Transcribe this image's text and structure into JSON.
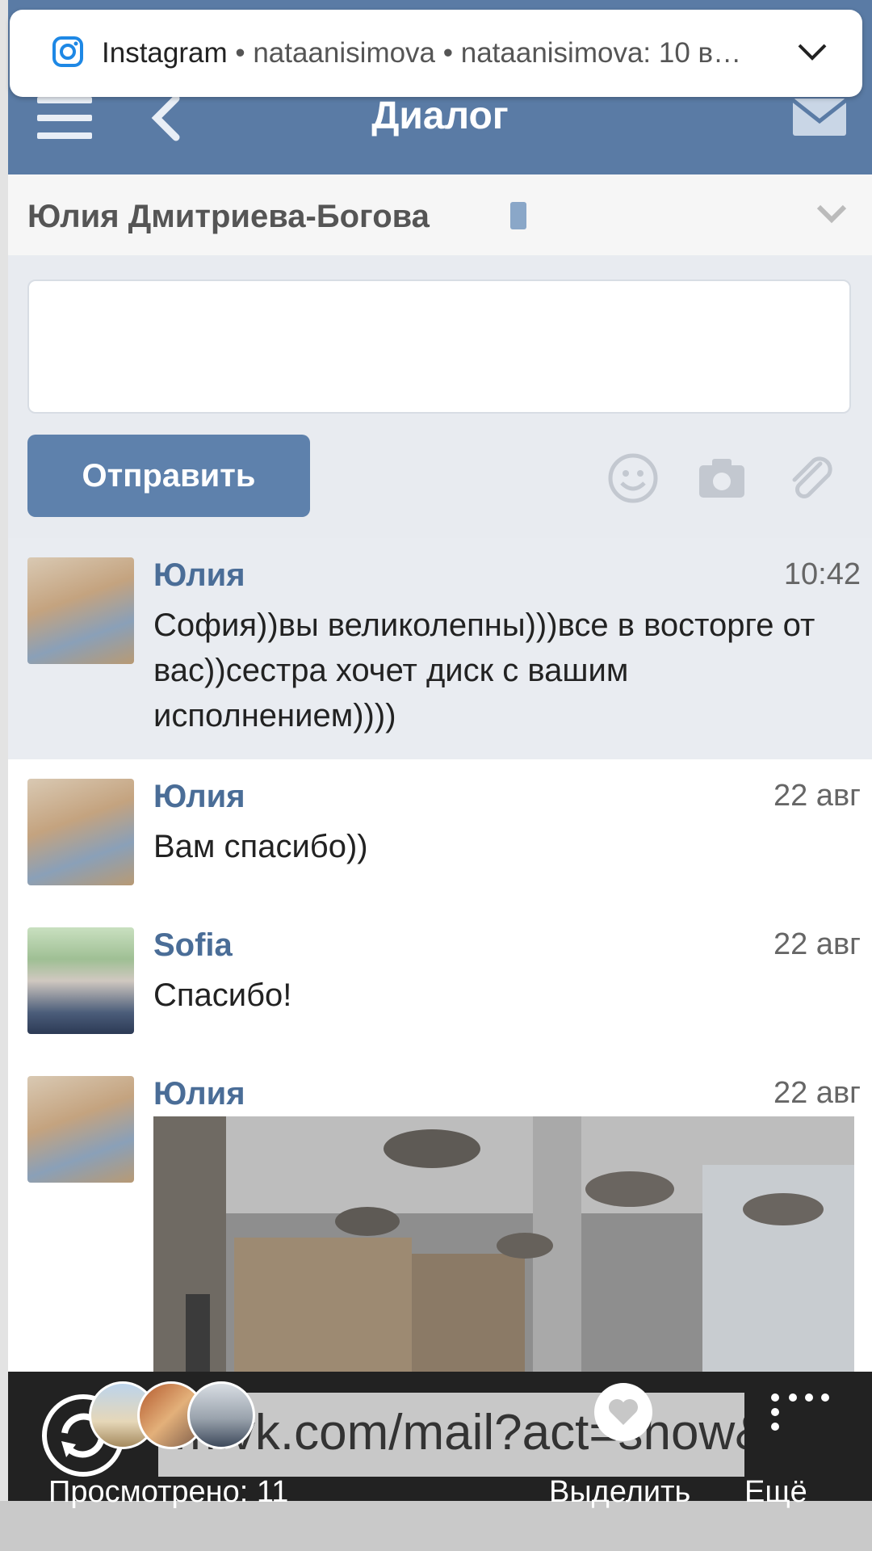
{
  "notification": {
    "app": "Instagram",
    "text": "• nataanisimova • nataanisimova: 10 в…"
  },
  "vk": {
    "header_title": "Диалог",
    "contact_name": "Юлия Дмитриева-Богова",
    "send_label": "Отправить",
    "messages": [
      {
        "author": "Юлия",
        "time": "10:42",
        "text": "София))вы великолепны)))все в восторге от вас))сестра хочет диск с вашим исполнением))))"
      },
      {
        "author": "Юлия",
        "time": "22 авг",
        "text": "Вам спасибо))"
      },
      {
        "author": "Sofia",
        "time": "22 авг",
        "text": "Спасибо!"
      },
      {
        "author": "Юлия",
        "time": "22 авг",
        "text": ""
      }
    ]
  },
  "story_bar": {
    "url": "m.vk.com/mail?act=show&p",
    "viewed": "Просмотрено: 11",
    "highlight": "Выделить",
    "more": "Ещё"
  },
  "colors": {
    "vk_blue": "#5a7ba5",
    "send_button": "#5e81ac",
    "author_blue": "#4a6d97"
  }
}
